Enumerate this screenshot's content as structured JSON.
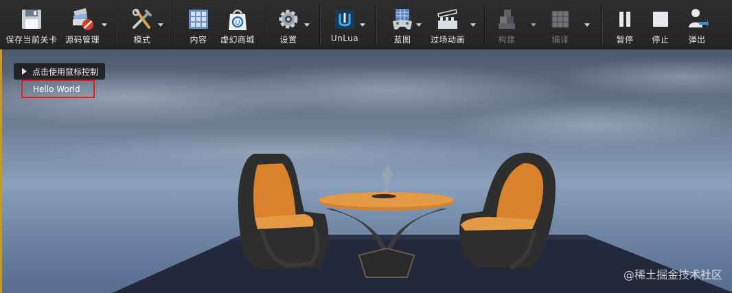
{
  "toolbar": {
    "buttons": [
      {
        "id": "save",
        "label": "保存当前关卡",
        "icon": "floppy-disk-icon"
      },
      {
        "id": "source",
        "label": "源码管理",
        "icon": "source-control-icon"
      },
      {
        "id": "modes",
        "label": "模式",
        "icon": "tools-icon"
      },
      {
        "id": "content",
        "label": "内容",
        "icon": "content-grid-icon"
      },
      {
        "id": "marketplace",
        "label": "虚幻商城",
        "icon": "marketplace-bag-icon"
      },
      {
        "id": "settings",
        "label": "设置",
        "icon": "gear-icon"
      },
      {
        "id": "unlua",
        "label": "UnLua",
        "icon": "unlua-logo-icon"
      },
      {
        "id": "blueprints",
        "label": "蓝图",
        "icon": "blueprint-gamepad-icon"
      },
      {
        "id": "cinematics",
        "label": "过场动画",
        "icon": "clapperboard-icon"
      },
      {
        "id": "build",
        "label": "构建",
        "icon": "build-blocks-icon"
      },
      {
        "id": "compile",
        "label": "编译",
        "icon": "compile-cubes-icon"
      },
      {
        "id": "pause",
        "label": "暂停",
        "icon": "pause-icon"
      },
      {
        "id": "stop",
        "label": "停止",
        "icon": "stop-icon"
      },
      {
        "id": "eject",
        "label": "弹出",
        "icon": "eject-person-icon"
      }
    ]
  },
  "viewport": {
    "hint": "点击使用鼠标控制",
    "hello": "Hello World",
    "watermark": "@稀土掘金技术社区"
  },
  "colors": {
    "accent_border": "#c89b1e",
    "highlight_box": "#e0201c",
    "chair_orange": "#d9822b"
  }
}
